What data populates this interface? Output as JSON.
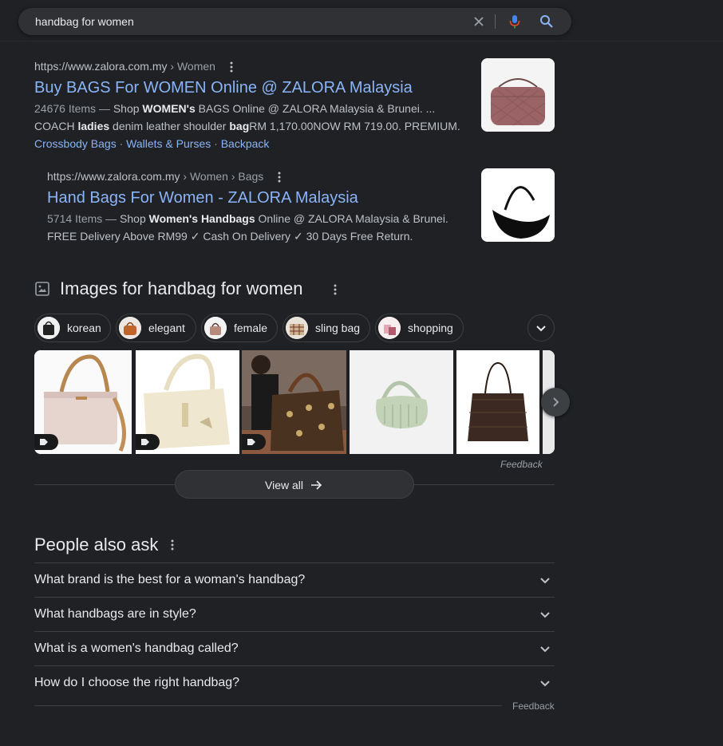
{
  "search": {
    "query": "handbag for women",
    "clear_icon": "close-icon",
    "mic_icon": "microphone-icon",
    "search_icon": "search-icon"
  },
  "results": [
    {
      "url": "https://www.zalora.com.my",
      "breadcrumb": " › Women",
      "title": "Buy BAGS For WOMEN Online @ ZALORA Malaysia",
      "snippet_meta": "24676 Items — ",
      "snippet_line1": "Shop WOMEN's BAGS Online @ ZALORA Malaysia & Brunei. ...",
      "snippet_line2": "COACH ladies denim leather shoulder bagRM 1,170.00NOW RM 719.00. PREMIUM.",
      "sitelinks": [
        "Crossbody Bags",
        "Wallets & Purses",
        "Backpack"
      ]
    },
    {
      "url": "https://www.zalora.com.my",
      "breadcrumb": " › Women › Bags",
      "title": "Hand Bags For Women - ZALORA Malaysia",
      "snippet_meta": "5714 Items — ",
      "snippet_line1": "Shop Women's Handbags Online @ ZALORA Malaysia & Brunei.",
      "snippet_line2": "FREE Delivery Above RM99 ✓ Cash On Delivery ✓ 30 Days Free Return."
    }
  ],
  "images": {
    "title": "Images for handbag for women",
    "chips": [
      "korean",
      "elegant",
      "female",
      "sling bag",
      "shopping"
    ],
    "feedback": "Feedback",
    "view_all": "View all"
  },
  "paa": {
    "title": "People also ask",
    "questions": [
      "What brand is the best for a woman's handbag?",
      "What handbags are in style?",
      "What is a women's handbag called?",
      "How do I choose the right handbag?"
    ],
    "feedback": "Feedback"
  },
  "colors": {
    "background": "#202124",
    "link": "#8ab4f8",
    "text": "#bdc1c6",
    "heading": "#e8eaed"
  }
}
